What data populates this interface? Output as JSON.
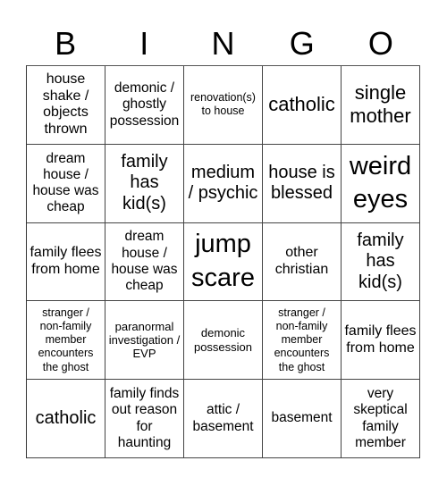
{
  "card": {
    "header": [
      "B",
      "I",
      "N",
      "G",
      "O"
    ],
    "rows": [
      [
        {
          "text": "house shake / objects thrown",
          "size": "s16"
        },
        {
          "text": "demonic / ghostly possession",
          "size": "s15"
        },
        {
          "text": "renovation(s) to house",
          "size": "s12"
        },
        {
          "text": "catholic",
          "size": "s22"
        },
        {
          "text": "single mother",
          "size": "s22"
        }
      ],
      [
        {
          "text": "dream house / house was cheap",
          "size": "s15"
        },
        {
          "text": "family has kid(s)",
          "size": "s20"
        },
        {
          "text": "medium / psychic",
          "size": "s20"
        },
        {
          "text": "house is blessed",
          "size": "s20"
        },
        {
          "text": "weird eyes",
          "size": "s29"
        }
      ],
      [
        {
          "text": "family flees from home",
          "size": "s16"
        },
        {
          "text": "dream house / house was cheap",
          "size": "s15"
        },
        {
          "text": "jump scare",
          "size": "s29"
        },
        {
          "text": "other christian",
          "size": "s16"
        },
        {
          "text": "family has kid(s)",
          "size": "s20"
        }
      ],
      [
        {
          "text": "stranger / non-family member encounters the ghost",
          "size": "s12"
        },
        {
          "text": "paranormal investigation / EVP",
          "size": "s13"
        },
        {
          "text": "demonic possession",
          "size": "s13"
        },
        {
          "text": "stranger / non-family member encounters the ghost",
          "size": "s12"
        },
        {
          "text": "family flees from home",
          "size": "s16"
        }
      ],
      [
        {
          "text": "catholic",
          "size": "s20"
        },
        {
          "text": "family finds out reason for haunting",
          "size": "s15"
        },
        {
          "text": "attic / basement",
          "size": "s15"
        },
        {
          "text": "basement",
          "size": "s15"
        },
        {
          "text": "very skeptical family member",
          "size": "s15"
        }
      ]
    ]
  }
}
